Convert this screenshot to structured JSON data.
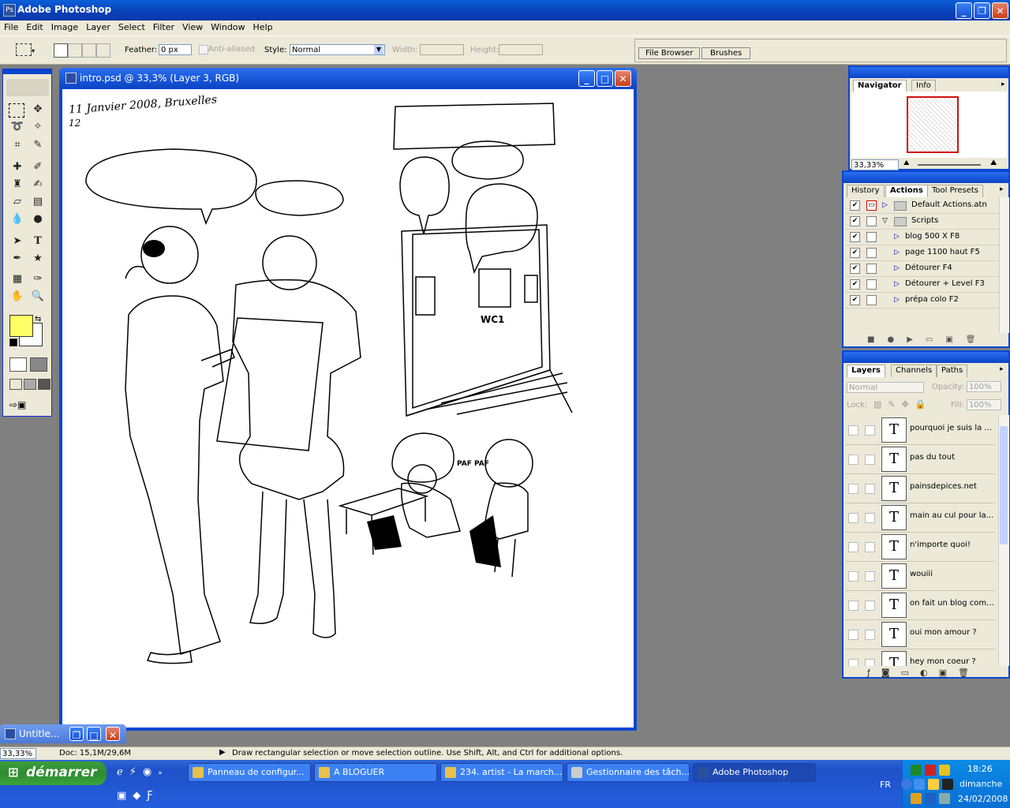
{
  "app": {
    "title": "Adobe Photoshop"
  },
  "menu": [
    "File",
    "Edit",
    "Image",
    "Layer",
    "Select",
    "Filter",
    "View",
    "Window",
    "Help"
  ],
  "options": {
    "feather_label": "Feather:",
    "feather_value": "0 px",
    "antialiased_label": "Anti-aliased",
    "style_label": "Style:",
    "style_value": "Normal",
    "width_label": "Width:",
    "height_label": "Height:",
    "well_tabs": [
      "File Browser",
      "Brushes"
    ]
  },
  "document": {
    "title": "intro.psd @ 33,3% (Layer 3, RGB)",
    "minimized_title": "Untitle...",
    "handwritten_date": "11 Janvier 2008, Bruxelles",
    "handwritten_num": "12",
    "door_label": "WC1",
    "sound_fx": "PAF PAF"
  },
  "navigator": {
    "tabs": [
      "Navigator",
      "Info"
    ],
    "active_tab": "Navigator",
    "zoom": "33,33%"
  },
  "actions": {
    "tabs": [
      "History",
      "Actions",
      "Tool Presets"
    ],
    "active_tab": "Actions",
    "items": [
      {
        "label": "Default Actions.atn",
        "type": "set",
        "expanded": false
      },
      {
        "label": "Scripts",
        "type": "set",
        "expanded": true
      },
      {
        "label": "blog 500 X  F8",
        "type": "action"
      },
      {
        "label": "page 1100 haut F5",
        "type": "action"
      },
      {
        "label": "Détourer F4",
        "type": "action"
      },
      {
        "label": "Détourer + Level F3",
        "type": "action"
      },
      {
        "label": "prépa colo  F2",
        "type": "action"
      }
    ]
  },
  "layers": {
    "tabs": [
      "Layers",
      "Channels",
      "Paths"
    ],
    "active_tab": "Layers",
    "blend_mode": "Normal",
    "opacity_label": "Opacity:",
    "opacity_value": "100%",
    "lock_label": "Lock:",
    "fill_label": "Fill:",
    "fill_value": "100%",
    "items": [
      "pourquoi je suis la ...",
      "pas du tout",
      "painsdepices.net",
      "main au cul pour la...",
      "n'importe quoi!",
      "wouiii",
      "on fait un blog com...",
      "oui mon amour  ?",
      "hey mon coeur  ?"
    ],
    "thumb_glyph": "T"
  },
  "status": {
    "zoom": "33,33%",
    "doc": "Doc: 15,1M/29,6M",
    "hint": "Draw rectangular selection or move selection outline.  Use Shift, Alt, and Ctrl for additional options."
  },
  "taskbar": {
    "start_label": "démarrer",
    "buttons": [
      "Panneau de configur...",
      "A BLOGUER",
      "234. artist - La march...",
      "Gestionnaire des tâch...",
      "Adobe Photoshop"
    ],
    "lang": "FR",
    "time": "18:26",
    "day": "dimanche",
    "date": "24/02/2008"
  },
  "colors": {
    "foreground": "#ffff66",
    "background": "#ffffff",
    "xp_blue": "#0a46d0"
  }
}
